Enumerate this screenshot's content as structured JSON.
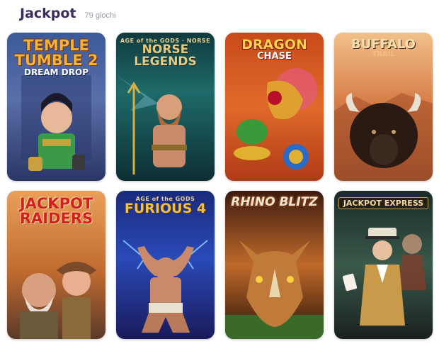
{
  "header": {
    "title": "Jackpot",
    "count": "79 giochi"
  },
  "games": [
    {
      "pre": "",
      "main": "TEMPLE TUMBLE 2",
      "sub": "DREAM DROP"
    },
    {
      "pre": "AGE of the GODS · NORSE",
      "main": "NORSE LEGENDS",
      "sub": ""
    },
    {
      "pre": "",
      "main": "DRAGON",
      "sub": "CHASE"
    },
    {
      "pre": "",
      "main": "BUFFALO",
      "sub": "TRAIL"
    },
    {
      "pre": "",
      "main": "JACKPOT RAIDERS",
      "sub": ""
    },
    {
      "pre": "AGE of the GODS",
      "main": "FURIOUS 4",
      "sub": ""
    },
    {
      "pre": "",
      "main": "RHINO BLITZ",
      "sub": ""
    },
    {
      "pre": "",
      "main": "JACKPOT EXPRESS",
      "sub": ""
    }
  ]
}
